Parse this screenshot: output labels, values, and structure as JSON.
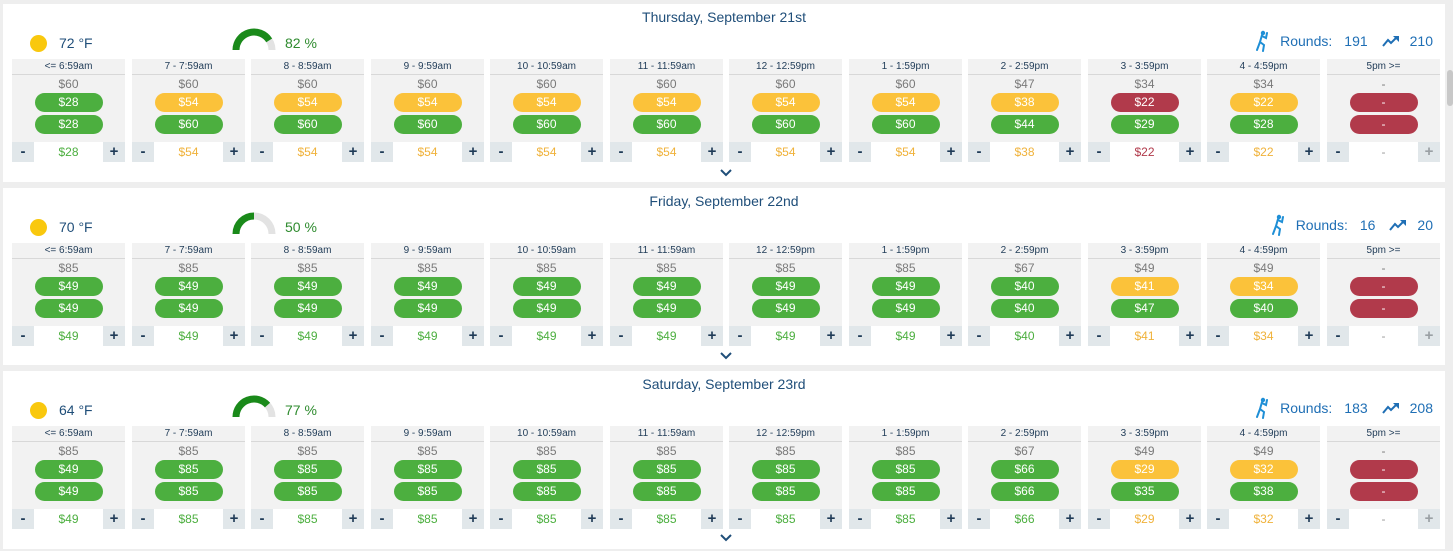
{
  "days": [
    {
      "title": "Thursday, September 21st",
      "temperature": "72 °F",
      "humidity": "82 %",
      "humidity_fraction": 0.82,
      "rounds_label": "Rounds:",
      "rounds_value": "191",
      "rounds_trend_value": "210",
      "slots": [
        {
          "label": "<= 6:59am",
          "base": "$60",
          "pill1": "$28",
          "pill1_color": "green",
          "pill2": "$28",
          "pill2_color": "green",
          "value": "$28",
          "value_color": "green"
        },
        {
          "label": "7 - 7:59am",
          "base": "$60",
          "pill1": "$54",
          "pill1_color": "yellow",
          "pill2": "$60",
          "pill2_color": "green",
          "value": "$54",
          "value_color": "yellow"
        },
        {
          "label": "8 - 8:59am",
          "base": "$60",
          "pill1": "$54",
          "pill1_color": "yellow",
          "pill2": "$60",
          "pill2_color": "green",
          "value": "$54",
          "value_color": "yellow"
        },
        {
          "label": "9 - 9:59am",
          "base": "$60",
          "pill1": "$54",
          "pill1_color": "yellow",
          "pill2": "$60",
          "pill2_color": "green",
          "value": "$54",
          "value_color": "yellow"
        },
        {
          "label": "10 - 10:59am",
          "base": "$60",
          "pill1": "$54",
          "pill1_color": "yellow",
          "pill2": "$60",
          "pill2_color": "green",
          "value": "$54",
          "value_color": "yellow"
        },
        {
          "label": "11 - 11:59am",
          "base": "$60",
          "pill1": "$54",
          "pill1_color": "yellow",
          "pill2": "$60",
          "pill2_color": "green",
          "value": "$54",
          "value_color": "yellow"
        },
        {
          "label": "12 - 12:59pm",
          "base": "$60",
          "pill1": "$54",
          "pill1_color": "yellow",
          "pill2": "$60",
          "pill2_color": "green",
          "value": "$54",
          "value_color": "yellow"
        },
        {
          "label": "1 - 1:59pm",
          "base": "$60",
          "pill1": "$54",
          "pill1_color": "yellow",
          "pill2": "$60",
          "pill2_color": "green",
          "value": "$54",
          "value_color": "yellow"
        },
        {
          "label": "2 - 2:59pm",
          "base": "$47",
          "pill1": "$38",
          "pill1_color": "yellow",
          "pill2": "$44",
          "pill2_color": "green",
          "value": "$38",
          "value_color": "yellow"
        },
        {
          "label": "3 - 3:59pm",
          "base": "$34",
          "pill1": "$22",
          "pill1_color": "red",
          "pill2": "$29",
          "pill2_color": "green",
          "value": "$22",
          "value_color": "red"
        },
        {
          "label": "4 - 4:59pm",
          "base": "$34",
          "pill1": "$22",
          "pill1_color": "yellow",
          "pill2": "$28",
          "pill2_color": "green",
          "value": "$22",
          "value_color": "yellow"
        },
        {
          "label": "5pm >=",
          "base": "-",
          "pill1": "-",
          "pill1_color": "red",
          "pill2": "-",
          "pill2_color": "red",
          "value": "-",
          "value_color": "grey"
        }
      ]
    },
    {
      "title": "Friday, September 22nd",
      "temperature": "70 °F",
      "humidity": "50 %",
      "humidity_fraction": 0.5,
      "rounds_label": "Rounds:",
      "rounds_value": "16",
      "rounds_trend_value": "20",
      "slots": [
        {
          "label": "<= 6:59am",
          "base": "$85",
          "pill1": "$49",
          "pill1_color": "green",
          "pill2": "$49",
          "pill2_color": "green",
          "value": "$49",
          "value_color": "green"
        },
        {
          "label": "7 - 7:59am",
          "base": "$85",
          "pill1": "$49",
          "pill1_color": "green",
          "pill2": "$49",
          "pill2_color": "green",
          "value": "$49",
          "value_color": "green"
        },
        {
          "label": "8 - 8:59am",
          "base": "$85",
          "pill1": "$49",
          "pill1_color": "green",
          "pill2": "$49",
          "pill2_color": "green",
          "value": "$49",
          "value_color": "green"
        },
        {
          "label": "9 - 9:59am",
          "base": "$85",
          "pill1": "$49",
          "pill1_color": "green",
          "pill2": "$49",
          "pill2_color": "green",
          "value": "$49",
          "value_color": "green"
        },
        {
          "label": "10 - 10:59am",
          "base": "$85",
          "pill1": "$49",
          "pill1_color": "green",
          "pill2": "$49",
          "pill2_color": "green",
          "value": "$49",
          "value_color": "green"
        },
        {
          "label": "11 - 11:59am",
          "base": "$85",
          "pill1": "$49",
          "pill1_color": "green",
          "pill2": "$49",
          "pill2_color": "green",
          "value": "$49",
          "value_color": "green"
        },
        {
          "label": "12 - 12:59pm",
          "base": "$85",
          "pill1": "$49",
          "pill1_color": "green",
          "pill2": "$49",
          "pill2_color": "green",
          "value": "$49",
          "value_color": "green"
        },
        {
          "label": "1 - 1:59pm",
          "base": "$85",
          "pill1": "$49",
          "pill1_color": "green",
          "pill2": "$49",
          "pill2_color": "green",
          "value": "$49",
          "value_color": "green"
        },
        {
          "label": "2 - 2:59pm",
          "base": "$67",
          "pill1": "$40",
          "pill1_color": "green",
          "pill2": "$40",
          "pill2_color": "green",
          "value": "$40",
          "value_color": "green"
        },
        {
          "label": "3 - 3:59pm",
          "base": "$49",
          "pill1": "$41",
          "pill1_color": "yellow",
          "pill2": "$47",
          "pill2_color": "green",
          "value": "$41",
          "value_color": "yellow"
        },
        {
          "label": "4 - 4:59pm",
          "base": "$49",
          "pill1": "$34",
          "pill1_color": "yellow",
          "pill2": "$40",
          "pill2_color": "green",
          "value": "$34",
          "value_color": "yellow"
        },
        {
          "label": "5pm >=",
          "base": "-",
          "pill1": "-",
          "pill1_color": "red",
          "pill2": "-",
          "pill2_color": "red",
          "value": "-",
          "value_color": "grey"
        }
      ]
    },
    {
      "title": "Saturday, September 23rd",
      "temperature": "64 °F",
      "humidity": "77 %",
      "humidity_fraction": 0.77,
      "rounds_label": "Rounds:",
      "rounds_value": "183",
      "rounds_trend_value": "208",
      "slots": [
        {
          "label": "<= 6:59am",
          "base": "$85",
          "pill1": "$49",
          "pill1_color": "green",
          "pill2": "$49",
          "pill2_color": "green",
          "value": "$49",
          "value_color": "green"
        },
        {
          "label": "7 - 7:59am",
          "base": "$85",
          "pill1": "$85",
          "pill1_color": "green",
          "pill2": "$85",
          "pill2_color": "green",
          "value": "$85",
          "value_color": "green"
        },
        {
          "label": "8 - 8:59am",
          "base": "$85",
          "pill1": "$85",
          "pill1_color": "green",
          "pill2": "$85",
          "pill2_color": "green",
          "value": "$85",
          "value_color": "green"
        },
        {
          "label": "9 - 9:59am",
          "base": "$85",
          "pill1": "$85",
          "pill1_color": "green",
          "pill2": "$85",
          "pill2_color": "green",
          "value": "$85",
          "value_color": "green"
        },
        {
          "label": "10 - 10:59am",
          "base": "$85",
          "pill1": "$85",
          "pill1_color": "green",
          "pill2": "$85",
          "pill2_color": "green",
          "value": "$85",
          "value_color": "green"
        },
        {
          "label": "11 - 11:59am",
          "base": "$85",
          "pill1": "$85",
          "pill1_color": "green",
          "pill2": "$85",
          "pill2_color": "green",
          "value": "$85",
          "value_color": "green"
        },
        {
          "label": "12 - 12:59pm",
          "base": "$85",
          "pill1": "$85",
          "pill1_color": "green",
          "pill2": "$85",
          "pill2_color": "green",
          "value": "$85",
          "value_color": "green"
        },
        {
          "label": "1 - 1:59pm",
          "base": "$85",
          "pill1": "$85",
          "pill1_color": "green",
          "pill2": "$85",
          "pill2_color": "green",
          "value": "$85",
          "value_color": "green"
        },
        {
          "label": "2 - 2:59pm",
          "base": "$67",
          "pill1": "$66",
          "pill1_color": "green",
          "pill2": "$66",
          "pill2_color": "green",
          "value": "$66",
          "value_color": "green"
        },
        {
          "label": "3 - 3:59pm",
          "base": "$49",
          "pill1": "$29",
          "pill1_color": "yellow",
          "pill2": "$35",
          "pill2_color": "green",
          "value": "$29",
          "value_color": "yellow"
        },
        {
          "label": "4 - 4:59pm",
          "base": "$49",
          "pill1": "$32",
          "pill1_color": "yellow",
          "pill2": "$38",
          "pill2_color": "green",
          "value": "$32",
          "value_color": "yellow"
        },
        {
          "label": "5pm >=",
          "base": "-",
          "pill1": "-",
          "pill1_color": "red",
          "pill2": "-",
          "pill2_color": "red",
          "value": "-",
          "value_color": "grey"
        }
      ]
    }
  ],
  "stepper": {
    "minus": "-",
    "plus": "+"
  },
  "icons": {
    "weather": "sun-icon",
    "rounds": "golfer-icon",
    "trend": "trend-up-icon",
    "expand": "chevron-down-icon"
  },
  "colors": {
    "green": "#4caf3f",
    "yellow": "#fbc23a",
    "red": "#b13a4b",
    "title": "#1f4e79",
    "rounds": "#1f6fb5",
    "gauge": "#1a8a1a"
  }
}
